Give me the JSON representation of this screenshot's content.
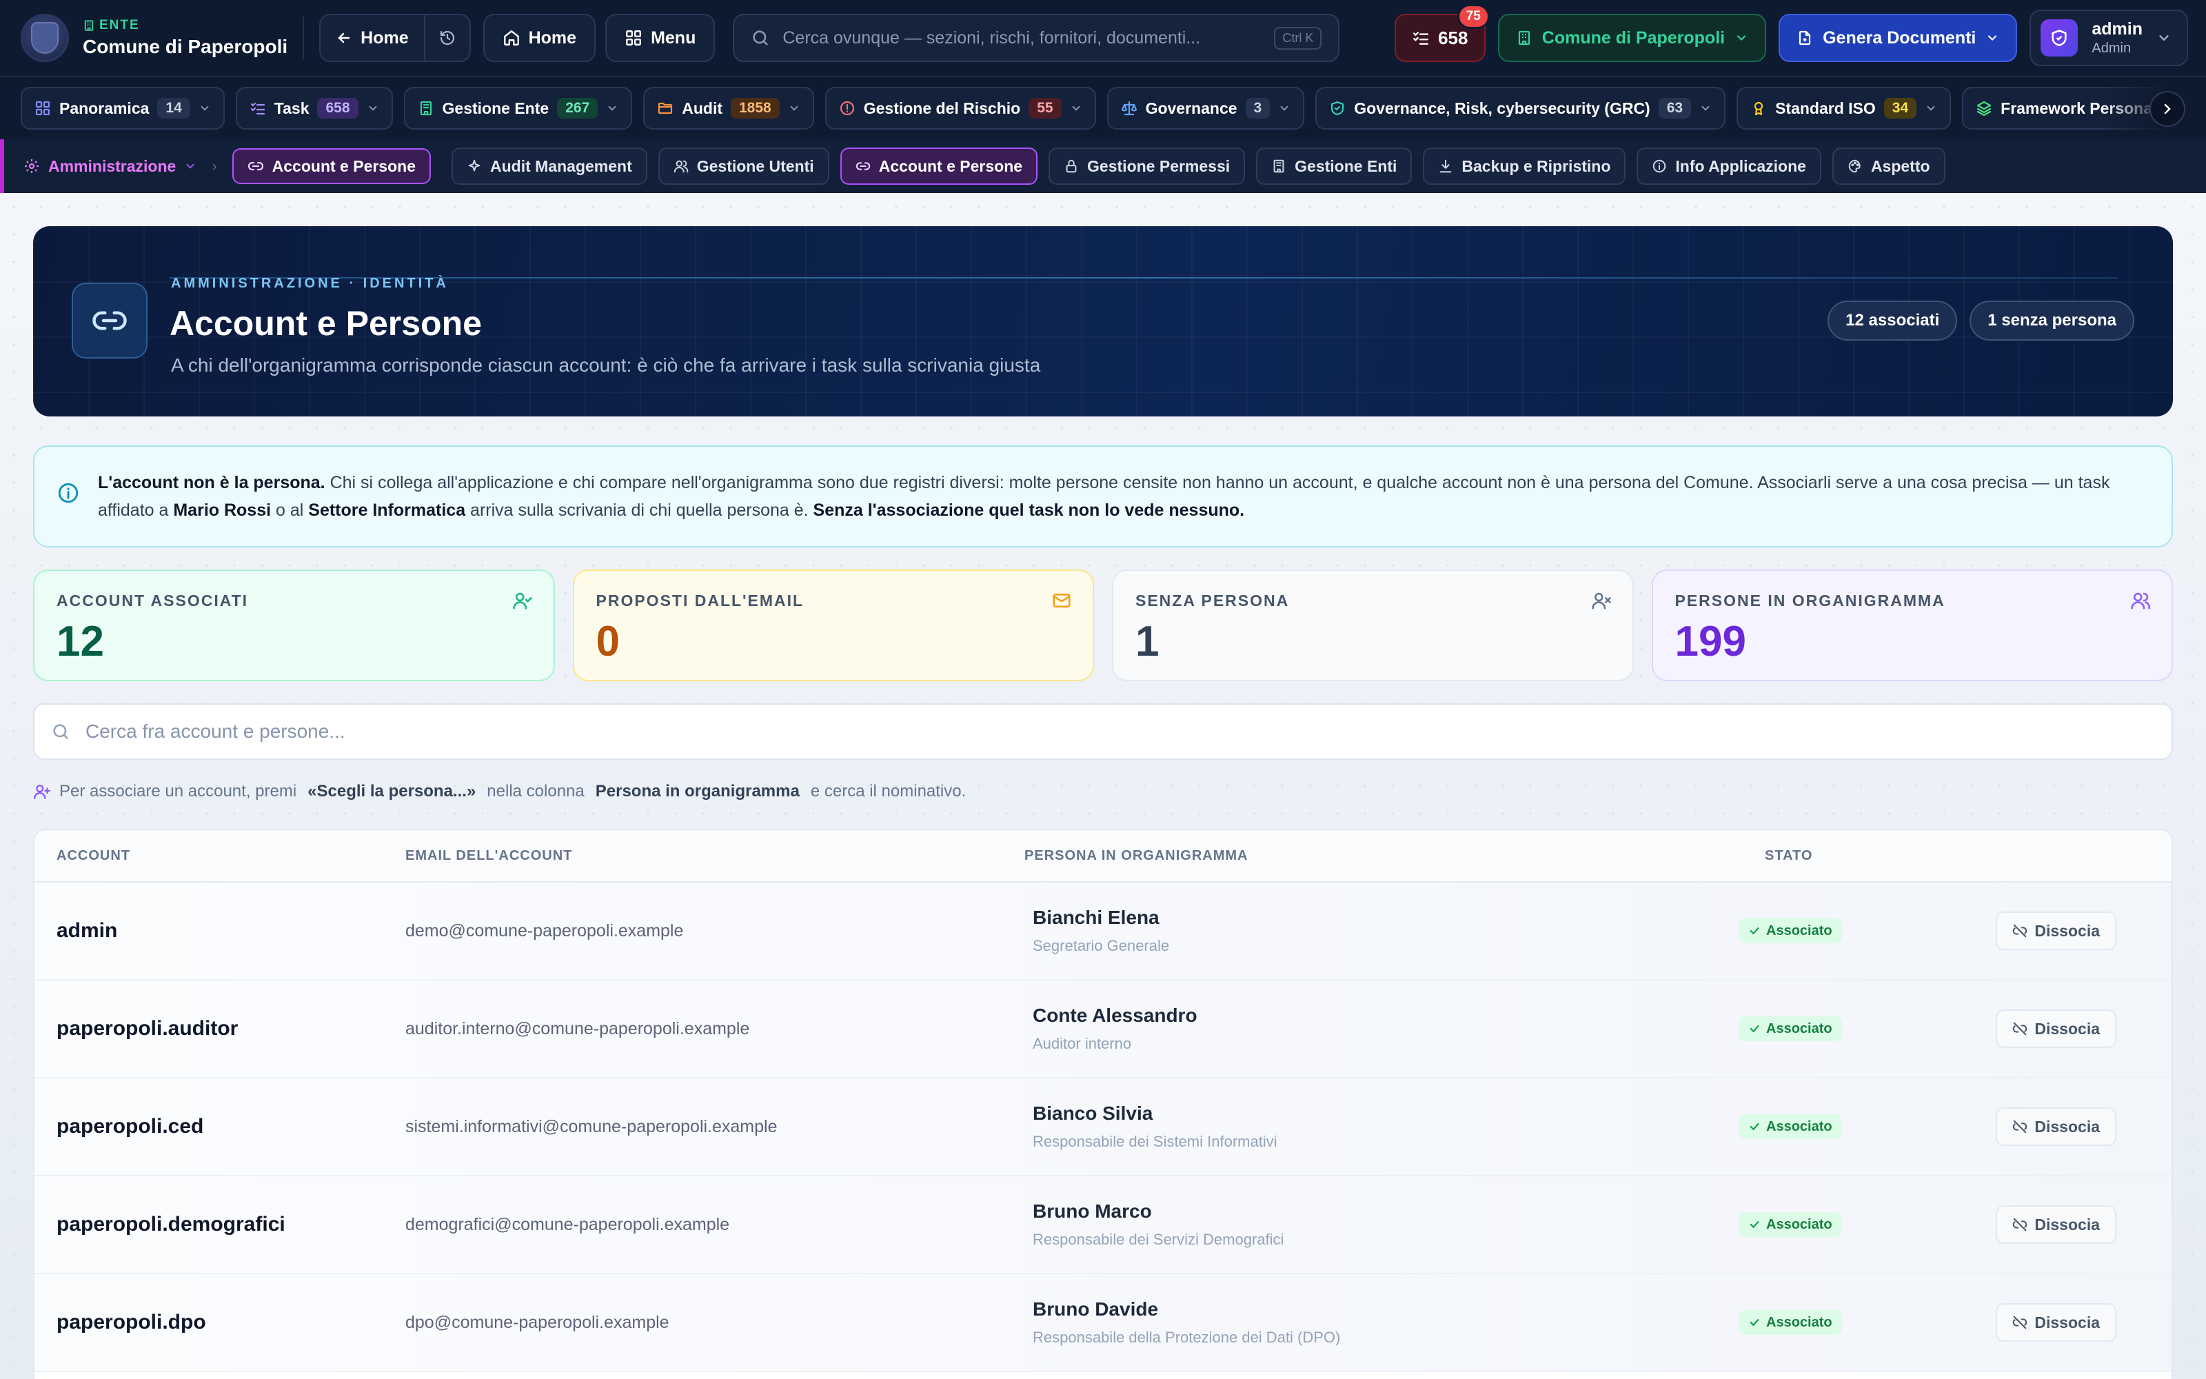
{
  "topbar": {
    "ente_label": "ENTE",
    "ente_name": "Comune di Paperopoli",
    "back_label": "Home",
    "home_label": "Home",
    "menu_label": "Menu",
    "search_placeholder": "Cerca ovunque — sezioni, rischi, fornitori, documenti...",
    "search_shortcut": "Ctrl K",
    "tasks_count": "658",
    "notifications_count": "75",
    "ente_selector": "Comune di Paperopoli",
    "generate_label": "Genera Documenti",
    "user_name": "admin",
    "user_role": "Admin"
  },
  "modules": [
    {
      "label": "Panoramica",
      "count": "14",
      "icon": "grid-icon",
      "color": "#818cf8",
      "count_bg": "#263350",
      "count_fg": "#cbd5e1"
    },
    {
      "label": "Task",
      "count": "658",
      "icon": "checklist-icon",
      "color": "#a78bfa",
      "count_bg": "#3b2a6b",
      "count_fg": "#c4b5fd"
    },
    {
      "label": "Gestione Ente",
      "count": "267",
      "icon": "building-icon",
      "color": "#34d399",
      "count_bg": "#124436",
      "count_fg": "#6ee7b7"
    },
    {
      "label": "Audit",
      "count": "1858",
      "icon": "folder-icon",
      "color": "#fb923c",
      "count_bg": "#4a2c17",
      "count_fg": "#fdba74"
    },
    {
      "label": "Gestione del Rischio",
      "count": "55",
      "icon": "alert-icon",
      "color": "#f87171",
      "count_bg": "#4d1d26",
      "count_fg": "#fca5a5"
    },
    {
      "label": "Governance",
      "count": "3",
      "icon": "scale-icon",
      "color": "#60a5fa",
      "count_bg": "#263350",
      "count_fg": "#cbd5e1"
    },
    {
      "label": "Governance, Risk, cybersecurity (GRC)",
      "count": "63",
      "icon": "shield-icon",
      "color": "#2dd4bf",
      "count_bg": "#263350",
      "count_fg": "#cbd5e1"
    },
    {
      "label": "Standard ISO",
      "count": "34",
      "icon": "award-icon",
      "color": "#facc15",
      "count_bg": "#4a3d12",
      "count_fg": "#fde047"
    },
    {
      "label": "Framework Personalizzati",
      "count": "",
      "icon": "layers-icon",
      "color": "#4ade80",
      "count_bg": "#263350",
      "count_fg": "#cbd5e1"
    }
  ],
  "subnav": {
    "section": "Amministrazione",
    "current": "Account e Persone",
    "items": [
      {
        "label": "Audit Management",
        "icon": "sparkle-icon",
        "active": false
      },
      {
        "label": "Gestione Utenti",
        "icon": "users-icon",
        "active": false
      },
      {
        "label": "Account e Persone",
        "icon": "link-icon",
        "active": true
      },
      {
        "label": "Gestione Permessi",
        "icon": "lock-icon",
        "active": false
      },
      {
        "label": "Gestione Enti",
        "icon": "building-icon",
        "active": false
      },
      {
        "label": "Backup e Ripristino",
        "icon": "download-icon",
        "active": false
      },
      {
        "label": "Info Applicazione",
        "icon": "info-icon",
        "active": false
      },
      {
        "label": "Aspetto",
        "icon": "palette-icon",
        "active": false
      }
    ]
  },
  "hero": {
    "eyebrow": "AMMINISTRAZIONE · IDENTITÀ",
    "title": "Account e Persone",
    "subtitle": "A chi dell'organigramma corrisponde ciascun account: è ciò che fa arrivare i task sulla scrivania giusta",
    "pill_linked": "12 associati",
    "pill_unlinked": "1 senza persona"
  },
  "note": {
    "lead": "L'account non è la persona.",
    "text1": " Chi si collega all'applicazione e chi compare nell'organigramma sono due registri diversi: molte persone censite non hanno un account, e qualche account non è una persona del Comune. Associarli serve a una cosa precisa — un task affidato a ",
    "name": "Mario Rossi",
    "text2": " o al ",
    "sector": "Settore Informatica",
    "text3": " arriva sulla scrivania di chi quella persona è. ",
    "tail": "Senza l'associazione quel task non lo vede nessuno."
  },
  "stats": [
    {
      "label": "ACCOUNT ASSOCIATI",
      "value": "12",
      "icon": "user-check-icon",
      "bg": "#ecfdf5",
      "border": "#a7f3d0",
      "fg": "#065f46",
      "lbl": "#475569",
      "ic": "#10b981"
    },
    {
      "label": "PROPOSTI DALL'EMAIL",
      "value": "0",
      "icon": "mail-icon",
      "bg": "#fffbeb",
      "border": "#fde68a",
      "fg": "#b45309",
      "lbl": "#475569",
      "ic": "#f59e0b"
    },
    {
      "label": "SENZA PERSONA",
      "value": "1",
      "icon": "user-x-icon",
      "bg": "#f8fafc",
      "border": "#e2e8f0",
      "fg": "#334155",
      "lbl": "#475569",
      "ic": "#64748b"
    },
    {
      "label": "PERSONE IN ORGANIGRAMMA",
      "value": "199",
      "icon": "users-icon",
      "bg": "#f5f3ff",
      "border": "#ddd6fe",
      "fg": "#6d28d9",
      "lbl": "#475569",
      "ic": "#8b5cf6"
    }
  ],
  "filter": {
    "placeholder": "Cerca fra account e persone..."
  },
  "hint": {
    "t1": "Per associare un account, premi",
    "b1": "«Scegli la persona...»",
    "t2": "nella colonna",
    "b2": "Persona in organigramma",
    "t3": "e cerca il nominativo."
  },
  "table": {
    "headers": [
      "ACCOUNT",
      "EMAIL DELL'ACCOUNT",
      "PERSONA IN ORGANIGRAMMA",
      "STATO"
    ],
    "rows": [
      {
        "account": "admin",
        "email": "demo@comune-paperopoli.example",
        "person": "Bianchi Elena",
        "role": "Segretario Generale",
        "status": "Associato",
        "action": "Dissocia"
      },
      {
        "account": "paperopoli.auditor",
        "email": "auditor.interno@comune-paperopoli.example",
        "person": "Conte Alessandro",
        "role": "Auditor interno",
        "status": "Associato",
        "action": "Dissocia"
      },
      {
        "account": "paperopoli.ced",
        "email": "sistemi.informativi@comune-paperopoli.example",
        "person": "Bianco Silvia",
        "role": "Responsabile dei Sistemi Informativi",
        "status": "Associato",
        "action": "Dissocia"
      },
      {
        "account": "paperopoli.demografici",
        "email": "demografici@comune-paperopoli.example",
        "person": "Bruno Marco",
        "role": "Responsabile dei Servizi Demografici",
        "status": "Associato",
        "action": "Dissocia"
      },
      {
        "account": "paperopoli.dpo",
        "email": "dpo@comune-paperopoli.example",
        "person": "Bruno Davide",
        "role": "Responsabile della Protezione dei Dati (DPO)",
        "status": "Associato",
        "action": "Dissocia"
      }
    ]
  }
}
